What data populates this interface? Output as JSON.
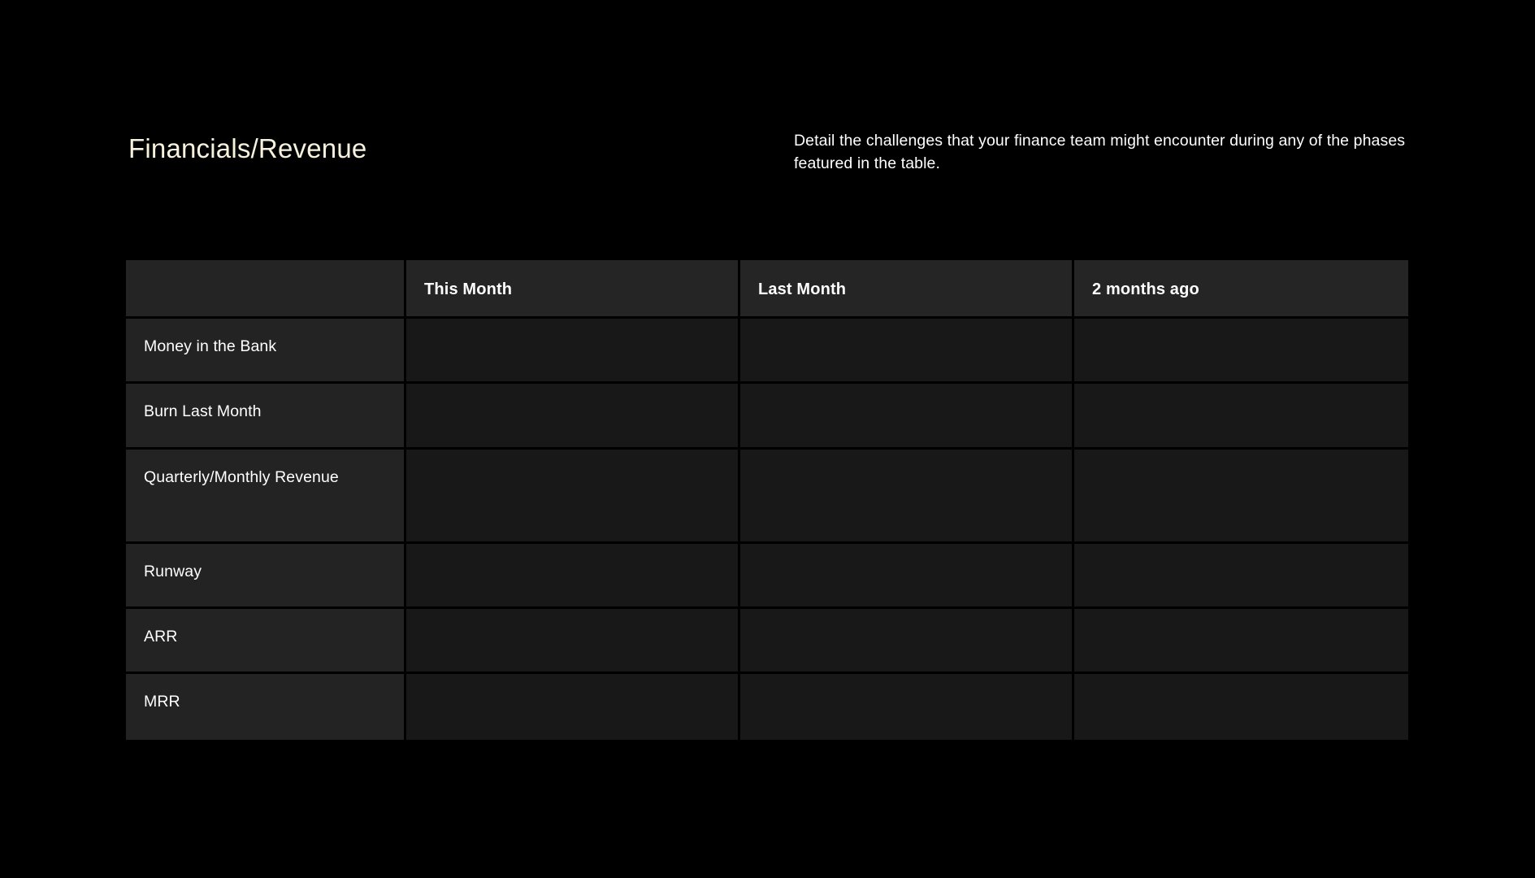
{
  "header": {
    "title": "Financials/Revenue",
    "subtitle": "Detail the challenges that your finance team might encounter during any of the phases featured in the table."
  },
  "colors": {
    "background": "#000000",
    "title_text": "#f7f2de",
    "body_text": "#ffffff",
    "header_cell": "#252525",
    "label_cell": "#232323",
    "data_cell": "#181818",
    "gridline": "#000000"
  },
  "table": {
    "corner_label": "",
    "columns": [
      {
        "label": "This Month"
      },
      {
        "label": "Last Month"
      },
      {
        "label": "2 months ago"
      }
    ],
    "rows": [
      {
        "label": "Money in the Bank",
        "cells": [
          "",
          "",
          ""
        ]
      },
      {
        "label": "Burn Last Month",
        "cells": [
          "",
          "",
          ""
        ]
      },
      {
        "label": "Quarterly/Monthly Revenue",
        "cells": [
          "",
          "",
          ""
        ]
      },
      {
        "label": "Runway",
        "cells": [
          "",
          "",
          ""
        ]
      },
      {
        "label": "ARR",
        "cells": [
          "",
          "",
          ""
        ]
      },
      {
        "label": "MRR",
        "cells": [
          "",
          "",
          ""
        ]
      }
    ]
  }
}
